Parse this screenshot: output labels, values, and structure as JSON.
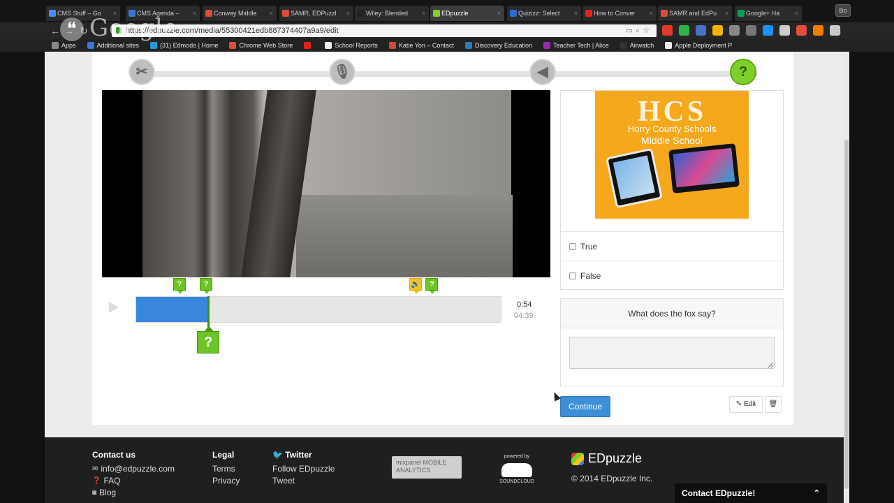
{
  "browser": {
    "tabs": [
      {
        "label": "CMS Stuff – Go",
        "color": "#4a8af4"
      },
      {
        "label": "CMS Agenda –",
        "color": "#3a76d8"
      },
      {
        "label": "Conway Middle",
        "color": "#dd4b39"
      },
      {
        "label": "SAMR, EDPuzzl",
        "color": "#dd4b39"
      },
      {
        "label": "Wiley: Blended",
        "color": "#222222"
      },
      {
        "label": "EDpuzzle",
        "color": "#7fcf2a"
      },
      {
        "label": "Quizizz: Select",
        "color": "#2d6cd4"
      },
      {
        "label": "How to Conver",
        "color": "#e62117"
      },
      {
        "label": "SAMR and EdPu",
        "color": "#dd4b39"
      },
      {
        "label": "Google+ Ha",
        "color": "#0f9d58"
      }
    ],
    "active_tab_index": 5,
    "window_button": "Bo",
    "url": "https://edpuzzle.com/media/55300421edb887374407a9a9/edit",
    "bookmarks": [
      {
        "label": "Apps",
        "color": "#888888"
      },
      {
        "label": "Additional sites",
        "color": "#3a76d8"
      },
      {
        "label": "(31) Edmodo | Home",
        "color": "#1f9cd8"
      },
      {
        "label": "Chrome Web Store",
        "color": "#e54c3c"
      },
      {
        "label": "",
        "color": "#e62117"
      },
      {
        "label": "School Reports",
        "color": "#eeeeee"
      },
      {
        "label": "Katie Yon – Contact",
        "color": "#d14836"
      },
      {
        "label": "Discovery Education",
        "color": "#2d7bb8"
      },
      {
        "label": "Teacher Tech | Alice",
        "color": "#9c27b0"
      },
      {
        "label": "Airwatch",
        "color": "#333333"
      },
      {
        "label": "Apple Deployment P",
        "color": "#eeeeee"
      }
    ],
    "watermark": "Google",
    "extension_colors": [
      "#e23a2a",
      "#2db34a",
      "#4472c4",
      "#f4b400",
      "#888888",
      "#777777",
      "#1e90ff",
      "#cccccc",
      "#e54c3c",
      "#f57c00",
      "#cccccc"
    ]
  },
  "steps": {
    "items": [
      {
        "name": "cut",
        "icon": "scissors-icon",
        "glyph": "✂"
      },
      {
        "name": "voiceover",
        "icon": "microphone-icon",
        "glyph": "🎙"
      },
      {
        "name": "audio-notes",
        "icon": "speaker-icon",
        "glyph": "◀"
      },
      {
        "name": "quiz",
        "icon": "question-icon",
        "glyph": "?"
      }
    ],
    "active_index": 3
  },
  "timeline": {
    "progress_fraction": 0.197,
    "current_time": "0:54",
    "total_time": "04:39",
    "markers": [
      {
        "type": "question",
        "label": "?",
        "fraction": 0.12
      },
      {
        "type": "question",
        "label": "?",
        "fraction": 0.193
      },
      {
        "type": "audio",
        "label": "🔊",
        "fraction": 0.765
      },
      {
        "type": "question",
        "label": "?",
        "fraction": 0.81
      }
    ],
    "selected_marker": {
      "label": "?",
      "fraction": 0.197
    }
  },
  "quiz": {
    "image_title": "HCS",
    "image_caption_1": "Horry County Schools",
    "image_caption_2": "Middle School",
    "options": [
      {
        "label": "True"
      },
      {
        "label": "False"
      }
    ]
  },
  "question": {
    "title": "What does the fox say?",
    "answer_value": ""
  },
  "actions": {
    "continue_label": "Continue",
    "edit_label": "Edit"
  },
  "footer": {
    "contact": {
      "heading": "Contact us",
      "links": [
        "info@edpuzzle.com",
        "FAQ",
        "Blog"
      ],
      "icons": [
        "envelope-icon",
        "question-circle-icon",
        "rss-icon"
      ]
    },
    "legal": {
      "heading": "Legal",
      "links": [
        "Terms",
        "Privacy"
      ]
    },
    "twitter": {
      "heading": "Twitter",
      "links": [
        "Follow EDpuzzle",
        "Tweet"
      ]
    },
    "mixpanel_text": "mixpanel MOBILE ANALYTICS",
    "soundcloud_top": "powered by",
    "soundcloud_bottom": "SOUNDCLOUD",
    "brand": "EDpuzzle",
    "copyright": "© 2014 EDpuzzle Inc.",
    "contact_bar": "Contact EDpuzzle!"
  }
}
